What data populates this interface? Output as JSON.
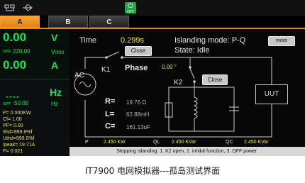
{
  "statusbar": {
    "power_label": "OFF"
  },
  "tabs": [
    {
      "label": "A"
    },
    {
      "label": "B"
    },
    {
      "label": "C"
    }
  ],
  "meters": {
    "voltage": "0.00",
    "voltage_unit": "V",
    "sv_label": "sv=",
    "voltage_set": "220.00",
    "voltage_rms_unit": "Vrms",
    "current": "0.00",
    "current_unit": "A",
    "frequency": "----",
    "frequency_unit": "Hz",
    "frequency_set": "50.00",
    "frequency_set_unit": "Hz",
    "stats": [
      "P= 0.000KW",
      "Cf= 1.00",
      "PF= 0.00",
      "Ithd=999.9%f",
      "Uthd=999.9%f",
      "Ipeak= 19.71A",
      "P= 0.021"
    ]
  },
  "main": {
    "time_label": "Time",
    "time_value": "0.299s",
    "close_label": "Close",
    "k1_label": "K1",
    "k2_label": "K2",
    "phase_label": "Phase",
    "phase_value": "0.00 °",
    "mode_label": "Islanding mode:  P-Q",
    "state_label": "State: Idle",
    "more_label": "more",
    "ac_label": "AC",
    "uut_label": "UUT",
    "r_label": "R=",
    "r_value": "19.76 Ω",
    "l_label": "L=",
    "l_value": "62.88mH",
    "c_label": "C=",
    "c_value": "161.13uF",
    "p_label": "P",
    "p_value": "2.450 KW",
    "ql_label": "QL",
    "ql_value": "2.450 KVar",
    "qc_label": "QC",
    "qc_value": "2.450 KVar",
    "message": "Stopping islanding: 1. K2 open, 2. inhibit function, 3. OFF power."
  },
  "caption": "IT7900 电网模拟器---孤岛测试界面",
  "colors": {
    "accent": "#e08512",
    "meter_green": "#18e05c",
    "value_yellow": "#eee84a"
  }
}
